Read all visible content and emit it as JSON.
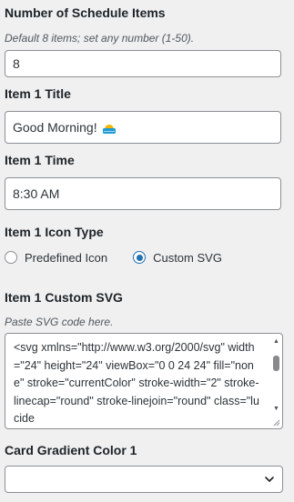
{
  "count_section": {
    "label": "Number of Schedule Items",
    "description": "Default 8 items; set any number (1-50).",
    "value": "8"
  },
  "item1_title": {
    "label": "Item 1 Title",
    "value": "Good Morning!",
    "emoji_icon": "sunrise-icon"
  },
  "item1_time": {
    "label": "Item 1 Time",
    "value": "8:30 AM"
  },
  "item1_icon_type": {
    "label": "Item 1 Icon Type",
    "options": [
      "Predefined Icon",
      "Custom SVG"
    ],
    "selected": "Custom SVG"
  },
  "item1_custom_svg": {
    "label": "Item 1 Custom SVG",
    "description": "Paste SVG code here.",
    "value": "<svg xmlns=\"http://www.w3.org/2000/svg\" width=\"24\" height=\"24\" viewBox=\"0 0 24 24\" fill=\"none\" stroke=\"currentColor\" stroke-width=\"2\" stroke-linecap=\"round\" stroke-linejoin=\"round\" class=\"lucide"
  },
  "card_gradient": {
    "label": "Card Gradient Color 1",
    "value": ""
  },
  "colors": {
    "background": "#f0f0f1",
    "accent": "#2271b1",
    "border": "#8c8f94"
  }
}
